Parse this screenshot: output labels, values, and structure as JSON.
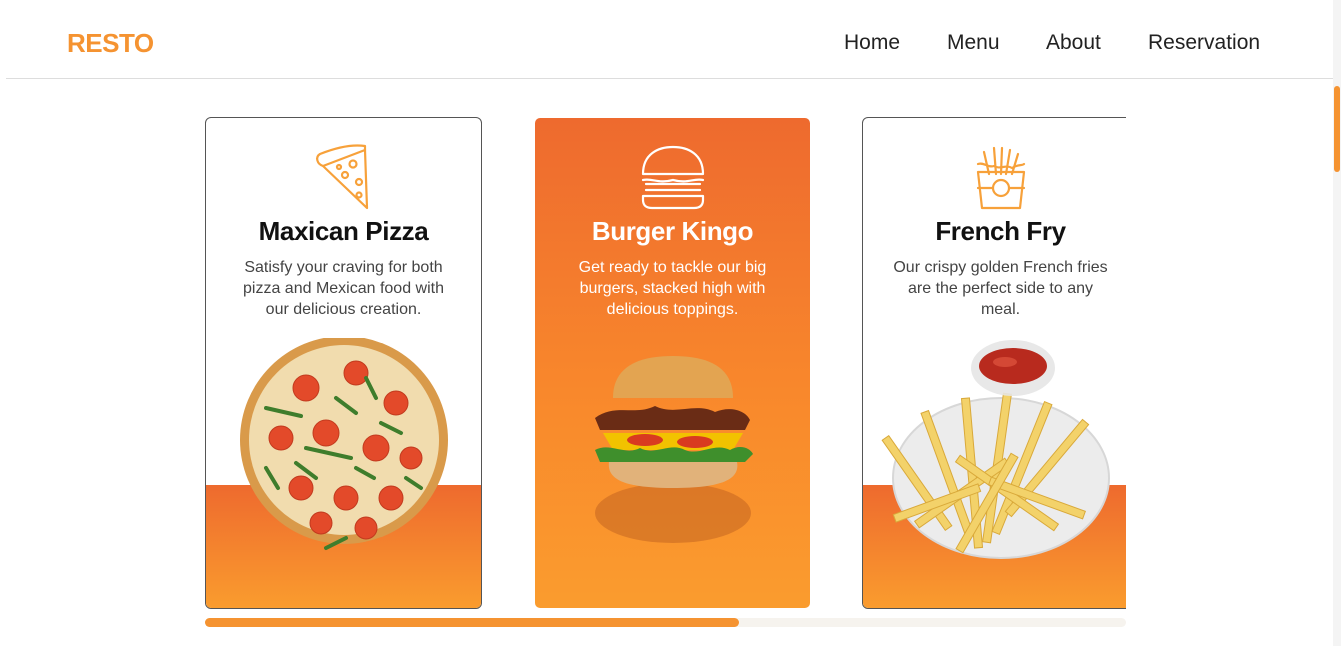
{
  "brand": {
    "name": "RESTO"
  },
  "nav": {
    "items": [
      {
        "label": "Home"
      },
      {
        "label": "Menu"
      },
      {
        "label": "About"
      },
      {
        "label": "Reservation"
      }
    ]
  },
  "cards": [
    {
      "title": "Maxican Pizza",
      "description": "Satisfy your craving for both pizza and Mexican food with our delicious creation.",
      "icon": "pizza-slice-icon",
      "image": "pizza-image"
    },
    {
      "title": "Burger Kingo",
      "description": "Get ready to tackle our big burgers, stacked high with delicious toppings.",
      "icon": "burger-icon",
      "image": "burger-image"
    },
    {
      "title": "French Fry",
      "description": "Our crispy golden French fries are the perfect side to any meal.",
      "icon": "french-fries-icon",
      "image": "fries-image"
    }
  ],
  "slider": {
    "scroll_progress": 0.58
  },
  "colors": {
    "accent": "#F59331",
    "accent_dark": "#EE6A2E",
    "accent_light": "#FA9C2E",
    "icon_stroke": "#F7A13A",
    "scroll_track": "#F6F3EE"
  }
}
